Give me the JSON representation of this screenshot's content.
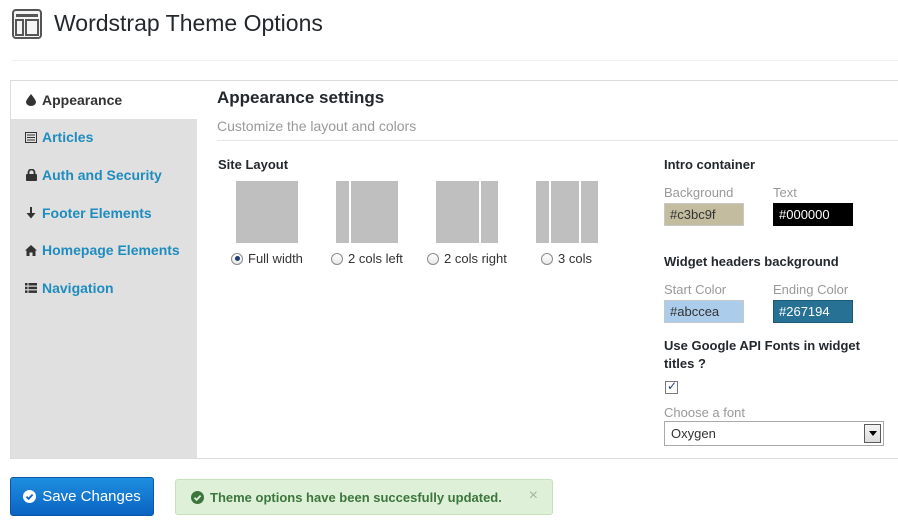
{
  "header": {
    "title": "Wordstrap Theme Options",
    "icon": "layout-icon"
  },
  "sidebar": {
    "items": [
      {
        "label": "Appearance",
        "icon": "drop-icon",
        "active": true
      },
      {
        "label": "Articles",
        "icon": "list-icon"
      },
      {
        "label": "Auth and Security",
        "icon": "lock-icon"
      },
      {
        "label": "Footer Elements",
        "icon": "arrow-down-icon"
      },
      {
        "label": "Homepage Elements",
        "icon": "home-icon"
      },
      {
        "label": "Navigation",
        "icon": "list-bullets-icon"
      }
    ]
  },
  "content": {
    "title": "Appearance settings",
    "subtitle": "Customize the layout and colors",
    "site_layout": {
      "heading": "Site Layout",
      "options": [
        {
          "label": "Full width",
          "checked": true
        },
        {
          "label": "2 cols left",
          "checked": false
        },
        {
          "label": "2 cols right",
          "checked": false
        },
        {
          "label": "3 cols",
          "checked": false
        }
      ]
    },
    "intro": {
      "heading": "Intro container",
      "background_label": "Background",
      "background_value": "#c3bc9f",
      "text_label": "Text",
      "text_value": "#000000"
    },
    "widget_headers": {
      "heading": "Widget headers background",
      "start_label": "Start Color",
      "start_value": "#abccea",
      "end_label": "Ending Color",
      "end_value": "#267194"
    },
    "google_fonts": {
      "heading": "Use Google API Fonts in widget titles ?",
      "checked": true,
      "choose_label": "Choose a font",
      "font_value": "Oxygen"
    }
  },
  "footer": {
    "save_label": "Save Changes",
    "alert_message": "Theme options have been succesfully updated.",
    "alert_close": "×"
  },
  "colors": {
    "link": "#1e8cbe",
    "sidebar_bg": "#e0e0e0",
    "primary_button": "#0a63c2",
    "success_bg": "#dff0d8",
    "success_text": "#3c763d"
  }
}
